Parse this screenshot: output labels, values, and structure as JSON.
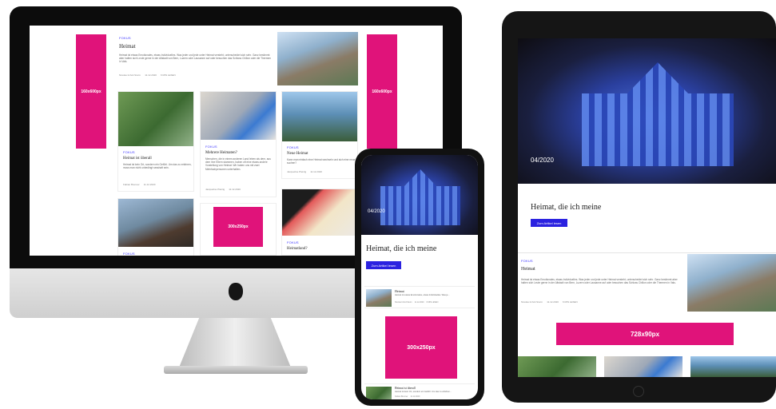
{
  "colors": {
    "accent": "#2b22e0",
    "ad": "#e0137a",
    "tag": "#3a33ff"
  },
  "desktop": {
    "featured": {
      "tag": "FOKUS",
      "title": "Heimat",
      "text": "Heimat ist etwas Emotionales, etwas Individuelles. Was jeder und jede unter Heimat versteht, unterscheidet sich sehr. Ganz bestimmt aber halten sich Leute gerne in der Altstadt von Bern, Luzern oder Lausanne auf oder besuchen das Schloss Chillon oder die Thermen in Vals.",
      "author": "Nicolas Imhof-Sturm",
      "date": "11.12.2020",
      "readtime": "6 MIN LESEN"
    },
    "ads": {
      "left": "160x600px",
      "right": "160x600px",
      "mid": "300x250px"
    },
    "cards": [
      {
        "tag": "FOKUS",
        "title": "Heimat ist überall",
        "text": "Heimat ist kein Ort, sondern ein Gefühl. Um das zu erfahren, muss man nicht unbedingt sesshaft sein.",
        "author": "Fabian Brenner",
        "date": "11.12.2020"
      },
      {
        "tag": "FOKUS",
        "title": "Mehrere Heimaten?",
        "text": "Menschen, die in einem anderen Land leben als dem, aus dem ihre Eltern stammen, haben oft eine etwas andere Vorstellung von Heimat. Wir haben uns mit zwei Mehrfachpersonen unterhalten.",
        "author": "Jacqueline Pletzig",
        "date": "11.12.2020"
      },
      {
        "tag": "FOKUS",
        "title": "Neue Heimat",
        "text": "Kann man einfach eine Heimat wechseln und sich eine neue suchen?",
        "author": "Jacqueline Pletzig",
        "date": "11.12.2020"
      }
    ],
    "bottom": [
      {
        "tag": "FOKUS"
      },
      {
        "tag": "FOKUS",
        "title": "Heimatland?"
      }
    ]
  },
  "phone": {
    "date": "04/2020",
    "hero_title": "Heimat, die ich meine",
    "button": "Zum Artikel lesen",
    "item": {
      "title": "Heimat",
      "text": "Heimat ist etwas Emotionales, etwas Individuelles. Was je...",
      "author": "Nicolas Imhof-Sturm",
      "date": "11.12.2020",
      "readtime": "6 MIN LESEN"
    },
    "ad": "300x250px",
    "item2": {
      "title": "Heimat ist überall",
      "text": "Heimat ist kein Ort, sondern ein Gefühl. Um das zu erfahren...",
      "author": "Fabian Brenner",
      "date": "11.12.2020"
    }
  },
  "tablet": {
    "date": "04/2020",
    "hero_title": "Heimat, die ich meine",
    "button": "Zum Artikel lesen",
    "item": {
      "tag": "FOKUS",
      "title": "Heimat",
      "text": "Heimat ist etwas Emotionales, etwas Individuelles. Was jeder und jede unter Heimat versteht, unterscheidet sich sehr. Ganz bestimmt aber halten sich Leute gerne in der Altstadt von Bern, Luzern oder Lausanne auf oder besuchen das Schloss Chillon oder die Thermen in Vals.",
      "author": "Nicolas Imhof-Sturm",
      "date": "11.12.2020",
      "readtime": "6 MIN LESEN"
    },
    "ad": "728x90px"
  }
}
